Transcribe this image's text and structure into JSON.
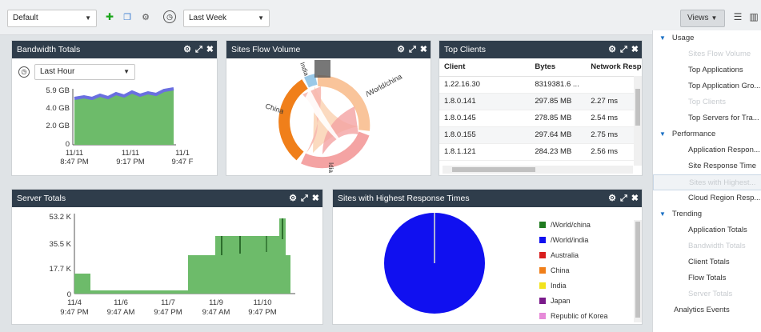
{
  "toolbar": {
    "dashboard_select": "Default",
    "time_select": "Last Week",
    "views_label": "Views"
  },
  "bandwidth": {
    "title": "Bandwidth Totals",
    "range_select": "Last Hour",
    "y_ticks": [
      "5.9 GB",
      "4.0 GB",
      "2.0 GB",
      "0"
    ],
    "x_ticks": [
      [
        "11/11",
        "8:47 PM"
      ],
      [
        "11/11",
        "9:17 PM"
      ],
      [
        "11/1",
        "9:47 F"
      ]
    ]
  },
  "flow": {
    "title": "Sites Flow Volume",
    "labels": [
      "China",
      "/World/china",
      "India",
      "Idia"
    ]
  },
  "clients": {
    "title": "Top Clients",
    "columns": [
      "Client",
      "Bytes",
      "Network Resp"
    ],
    "rows": [
      [
        "1.22.16.30",
        "8319381.6 ...",
        ""
      ],
      [
        "1.8.0.141",
        "297.85 MB",
        "2.27 ms"
      ],
      [
        "1.8.0.145",
        "278.85 MB",
        "2.54 ms"
      ],
      [
        "1.8.0.155",
        "297.64 MB",
        "2.75 ms"
      ],
      [
        "1.8.1.121",
        "284.23 MB",
        "2.56 ms"
      ]
    ]
  },
  "server": {
    "title": "Server Totals",
    "y_ticks": [
      "53.2 K",
      "35.5 K",
      "17.7 K",
      "0"
    ],
    "x_ticks": [
      [
        "11/4",
        "9:47 PM"
      ],
      [
        "11/6",
        "9:47 AM"
      ],
      [
        "11/7",
        "9:47 PM"
      ],
      [
        "11/9",
        "9:47 AM"
      ],
      [
        "11/10",
        "9:47 PM"
      ]
    ]
  },
  "response": {
    "title": "Sites with Highest Response Times",
    "legend": [
      {
        "label": "/World/china",
        "color": "#1f7a1f"
      },
      {
        "label": "/World/india",
        "color": "#1010f0"
      },
      {
        "label": "Australia",
        "color": "#d81e1e"
      },
      {
        "label": "China",
        "color": "#f07f1a"
      },
      {
        "label": "India",
        "color": "#f2e31c"
      },
      {
        "label": "Japan",
        "color": "#7a1a8a"
      },
      {
        "label": "Republic of Korea",
        "color": "#e68ad8"
      }
    ]
  },
  "sidebar": {
    "groups": [
      {
        "label": "Usage",
        "items": [
          {
            "label": "Sites Flow Volume",
            "state": "disabled"
          },
          {
            "label": "Top Applications",
            "state": "normal"
          },
          {
            "label": "Top Application Gro...",
            "state": "normal"
          },
          {
            "label": "Top Clients",
            "state": "disabled"
          },
          {
            "label": "Top Servers for Tra...",
            "state": "normal"
          }
        ]
      },
      {
        "label": "Performance",
        "items": [
          {
            "label": "Application Respon...",
            "state": "normal"
          },
          {
            "label": "Site Response Time",
            "state": "normal"
          },
          {
            "label": "Sites with Highest...",
            "state": "selected"
          },
          {
            "label": "Cloud Region Resp...",
            "state": "normal"
          }
        ]
      },
      {
        "label": "Trending",
        "items": [
          {
            "label": "Application Totals",
            "state": "normal"
          },
          {
            "label": "Bandwidth Totals",
            "state": "disabled"
          },
          {
            "label": "Client Totals",
            "state": "normal"
          },
          {
            "label": "Flow Totals",
            "state": "normal"
          },
          {
            "label": "Server Totals",
            "state": "disabled"
          }
        ]
      }
    ],
    "footer": "Analytics Events"
  },
  "colors": {
    "panel_header": "#2f3d4b",
    "chart_fill": "#6dbb6a",
    "chart_line": "#6a6fe0"
  }
}
